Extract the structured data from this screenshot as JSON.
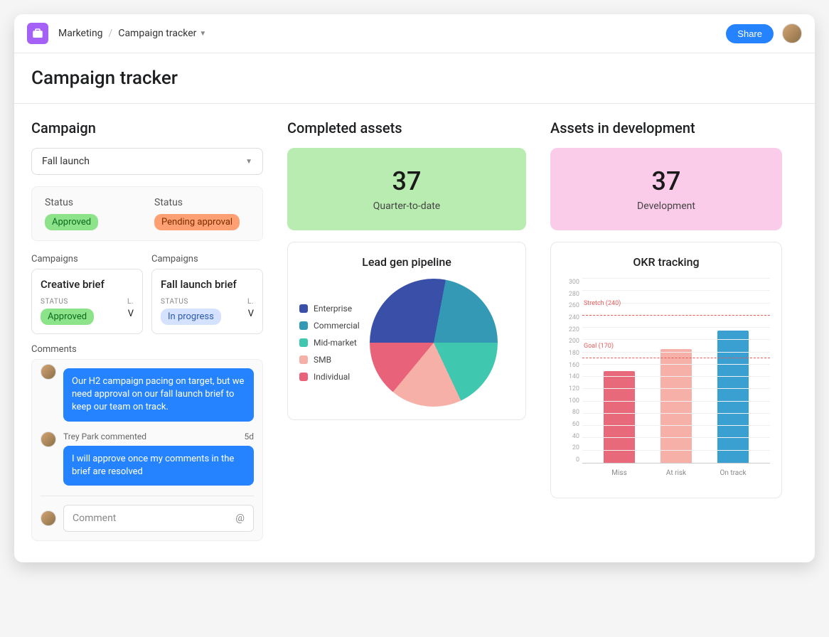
{
  "breadcrumb": {
    "workspace": "Marketing",
    "page": "Campaign tracker"
  },
  "share_label": "Share",
  "page_title": "Campaign tracker",
  "campaign": {
    "heading": "Campaign",
    "selected": "Fall launch",
    "status_label": "Status",
    "status1": "Approved",
    "status2": "Pending approval",
    "campaigns_label": "Campaigns",
    "card1": {
      "title": "Creative brief",
      "status_label": "STATUS",
      "status": "Approved",
      "l_label": "L.",
      "l": "V"
    },
    "card2": {
      "title": "Fall launch brief",
      "status_label": "STATUS",
      "status": "In progress",
      "l_label": "L.",
      "l": "V"
    },
    "comments_label": "Comments",
    "comment1": {
      "text": "Our H2 campaign pacing on target, but we need approval on our fall launch brief to keep our team on track."
    },
    "comment2": {
      "author": "Trey Park commented",
      "time": "5d",
      "text": "I will approve once my comments in the brief are resolved"
    },
    "comment_placeholder": "Comment",
    "mention_symbol": "@"
  },
  "completed": {
    "heading": "Completed assets",
    "value": "37",
    "label": "Quarter-to-date",
    "chart_title": "Lead gen pipeline"
  },
  "development": {
    "heading": "Assets in development",
    "value": "37",
    "label": "Development",
    "chart_title": "OKR tracking"
  },
  "chart_data": [
    {
      "type": "pie",
      "title": "Lead gen pipeline",
      "series": [
        {
          "name": "Enterprise",
          "value": 28,
          "color": "#3a4fa8"
        },
        {
          "name": "Commercial",
          "value": 22,
          "color": "#3399b5"
        },
        {
          "name": "Mid-market",
          "value": 18,
          "color": "#3fc7b0"
        },
        {
          "name": "SMB",
          "value": 18,
          "color": "#f6b0a8"
        },
        {
          "name": "Individual",
          "value": 14,
          "color": "#e8637a"
        }
      ]
    },
    {
      "type": "bar",
      "title": "OKR tracking",
      "categories": [
        "Miss",
        "At risk",
        "On track"
      ],
      "values": [
        150,
        185,
        215
      ],
      "colors": [
        "#e86a7a",
        "#f6b0a8",
        "#3a9fd1"
      ],
      "ylim": [
        0,
        300
      ],
      "ytick_step": 20,
      "reference_lines": [
        {
          "label": "Stretch (240)",
          "value": 240
        },
        {
          "label": "Goal (170)",
          "value": 170
        }
      ]
    }
  ]
}
